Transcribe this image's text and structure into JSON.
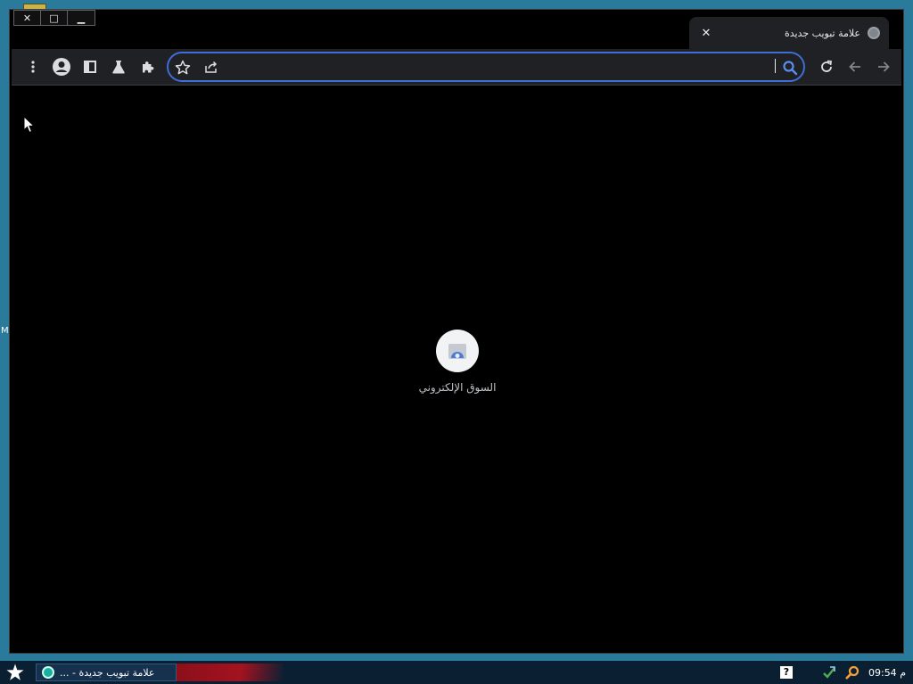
{
  "desktop": {
    "side_letter": "M"
  },
  "window": {
    "controls": {
      "close": "✕",
      "maximize": "□",
      "minimize": "▁"
    },
    "tab": {
      "title": "علامة تبويب جديدة",
      "close": "✕",
      "favicon": "globe-icon"
    },
    "toolbar": {
      "menu": "more-vert-icon",
      "profile": "account-circle-icon",
      "side_panel": "side-panel-icon",
      "labs": "flask-icon",
      "extensions": "puzzle-icon",
      "bookmark": "star-icon",
      "share": "share-icon",
      "search": "search-icon",
      "reload": "reload-icon",
      "back": "back-arrow-icon",
      "forward": "forward-arrow-icon",
      "omnibox_value": ""
    }
  },
  "new_tab": {
    "shortcuts": [
      {
        "label": "السوق الإلكتروني",
        "icon": "web-store-icon"
      }
    ]
  },
  "taskbar": {
    "start": "star-icon",
    "task_label": "علامة تبويب جديدة - ...",
    "tray": {
      "help": "?",
      "clock": "09:54 م"
    }
  },
  "colors": {
    "desktop": "#2a7a9c",
    "window_bg": "#000000",
    "toolbar_bg": "#202124",
    "omnibox_border": "#3e6ed6",
    "taskbar_bg": "#0b1f33",
    "search_blue": "#5b8def"
  }
}
